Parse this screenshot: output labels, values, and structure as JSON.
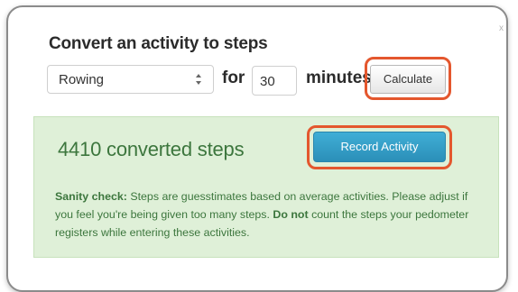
{
  "dialog": {
    "close_label": "x",
    "title": "Convert an activity to steps"
  },
  "form": {
    "activity_selected": "Rowing",
    "for_label": "for",
    "minutes_value": "30",
    "minutes_label": "minutes",
    "calculate_label": "Calculate"
  },
  "result": {
    "steps_text": "4410 converted steps",
    "record_label": "Record Activity"
  },
  "sanity": {
    "lead": "Sanity check:",
    "text_1": " Steps are guesstimates based on average activities. Please adjust if you feel you're being given too many steps. ",
    "do_not": "Do not",
    "text_2": " count the steps your pedometer registers while entering these activities."
  },
  "colors": {
    "highlight": "#e4572e",
    "success_bg": "#dff0d8",
    "success_text": "#3c763d",
    "primary_button": "#2b8fb8"
  },
  "icons": {
    "close": "close-icon",
    "select_arrows": "select-arrows-icon"
  }
}
